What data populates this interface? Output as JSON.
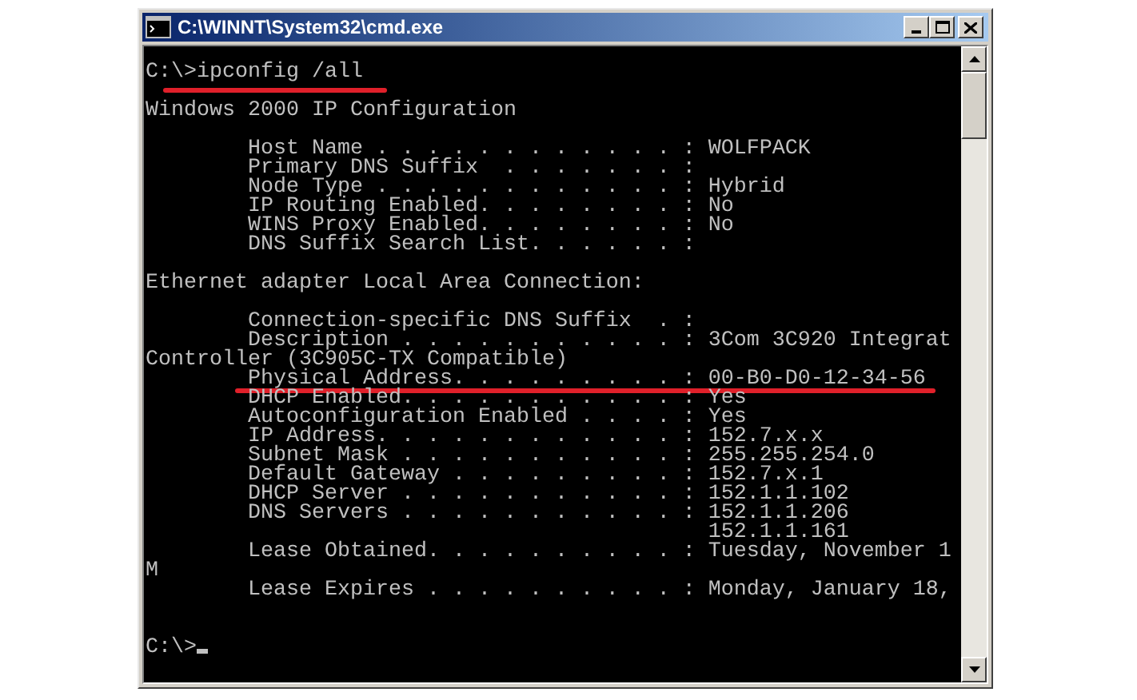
{
  "window": {
    "title": "C:\\WINNT\\System32\\cmd.exe"
  },
  "console": {
    "lines": [
      {
        "kind": "prompt",
        "prompt": "C:\\>",
        "command": "ipconfig /all",
        "underlined": true,
        "cursor": false
      },
      {
        "kind": "blank"
      },
      {
        "kind": "text",
        "text": "Windows 2000 IP Configuration",
        "underlined": false
      },
      {
        "kind": "blank"
      },
      {
        "kind": "text",
        "text": "        Host Name . . . . . . . . . . . . : WOLFPACK",
        "underlined": false
      },
      {
        "kind": "text",
        "text": "        Primary DNS Suffix  . . . . . . . :",
        "underlined": false
      },
      {
        "kind": "text",
        "text": "        Node Type . . . . . . . . . . . . : Hybrid",
        "underlined": false
      },
      {
        "kind": "text",
        "text": "        IP Routing Enabled. . . . . . . . : No",
        "underlined": false
      },
      {
        "kind": "text",
        "text": "        WINS Proxy Enabled. . . . . . . . : No",
        "underlined": false
      },
      {
        "kind": "text",
        "text": "        DNS Suffix Search List. . . . . . :",
        "underlined": false
      },
      {
        "kind": "blank"
      },
      {
        "kind": "text",
        "text": "Ethernet adapter Local Area Connection:",
        "underlined": false
      },
      {
        "kind": "blank"
      },
      {
        "kind": "text",
        "text": "        Connection-specific DNS Suffix  . :",
        "underlined": false
      },
      {
        "kind": "text",
        "text": "        Description . . . . . . . . . . . : 3Com 3C920 Integrat",
        "underlined": false
      },
      {
        "kind": "text",
        "text": "Controller (3C905C-TX Compatible)",
        "underlined": false
      },
      {
        "kind": "text",
        "text": "        Physical Address. . . . . . . . . : 00-B0-D0-12-34-56",
        "underlined": true
      },
      {
        "kind": "text",
        "text": "        DHCP Enabled. . . . . . . . . . . : Yes",
        "underlined": false
      },
      {
        "kind": "text",
        "text": "        Autoconfiguration Enabled . . . . : Yes",
        "underlined": false
      },
      {
        "kind": "text",
        "text": "        IP Address. . . . . . . . . . . . : 152.7.x.x",
        "underlined": false
      },
      {
        "kind": "text",
        "text": "        Subnet Mask . . . . . . . . . . . : 255.255.254.0",
        "underlined": false
      },
      {
        "kind": "text",
        "text": "        Default Gateway . . . . . . . . . : 152.7.x.1",
        "underlined": false
      },
      {
        "kind": "text",
        "text": "        DHCP Server . . . . . . . . . . . : 152.1.1.102",
        "underlined": false
      },
      {
        "kind": "text",
        "text": "        DNS Servers . . . . . . . . . . . : 152.1.1.206",
        "underlined": false
      },
      {
        "kind": "text",
        "text": "                                            152.1.1.161",
        "underlined": false
      },
      {
        "kind": "text",
        "text": "        Lease Obtained. . . . . . . . . . : Tuesday, November 1",
        "underlined": false
      },
      {
        "kind": "text",
        "text": "M",
        "underlined": false
      },
      {
        "kind": "text",
        "text": "        Lease Expires . . . . . . . . . . : Monday, January 18,",
        "underlined": false
      },
      {
        "kind": "blank"
      },
      {
        "kind": "blank"
      },
      {
        "kind": "prompt",
        "prompt": "C:\\>",
        "underlined": false,
        "cursor": true
      }
    ]
  }
}
